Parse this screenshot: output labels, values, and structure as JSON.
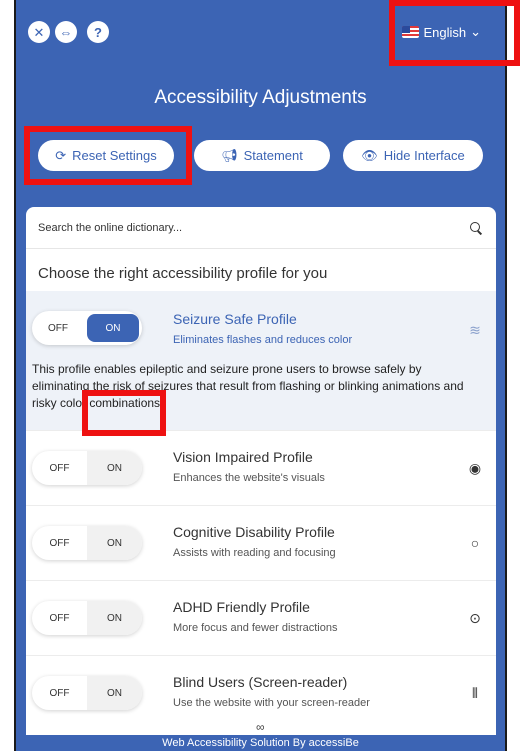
{
  "header": {
    "close_icon": "close-icon",
    "move_icon": "move-icon",
    "help_label": "?",
    "language": "English"
  },
  "title": "Accessibility Adjustments",
  "actions": {
    "reset": "Reset Settings",
    "statement": "Statement",
    "hide": "Hide Interface"
  },
  "search": {
    "placeholder": "Search the online dictionary..."
  },
  "section_heading": "Choose the right accessibility profile for you",
  "toggle": {
    "off": "OFF",
    "on": "ON"
  },
  "profiles": [
    {
      "name": "Seizure Safe Profile",
      "sub": "Eliminates flashes and reduces color",
      "desc": "This profile enables epileptic and seizure prone users to browse safely by eliminating the risk of seizures that result from flashing or blinking animations and risky color combinations.",
      "state": "on",
      "icon": "zigzag-icon"
    },
    {
      "name": "Vision Impaired Profile",
      "sub": "Enhances the website's visuals",
      "state": "off",
      "icon": "eye-icon"
    },
    {
      "name": "Cognitive Disability Profile",
      "sub": "Assists with reading and focusing",
      "state": "off",
      "icon": "circle-icon"
    },
    {
      "name": "ADHD Friendly Profile",
      "sub": "More focus and fewer distractions",
      "state": "off",
      "icon": "target-icon"
    },
    {
      "name": "Blind Users (Screen-reader)",
      "sub": "Use the website with your screen-reader",
      "state": "off",
      "icon": "audio-wave-icon"
    }
  ],
  "footer": "Web Accessibility Solution By accessiBe",
  "colors": {
    "brand": "#3c64b4",
    "highlight": "#ee1111"
  }
}
